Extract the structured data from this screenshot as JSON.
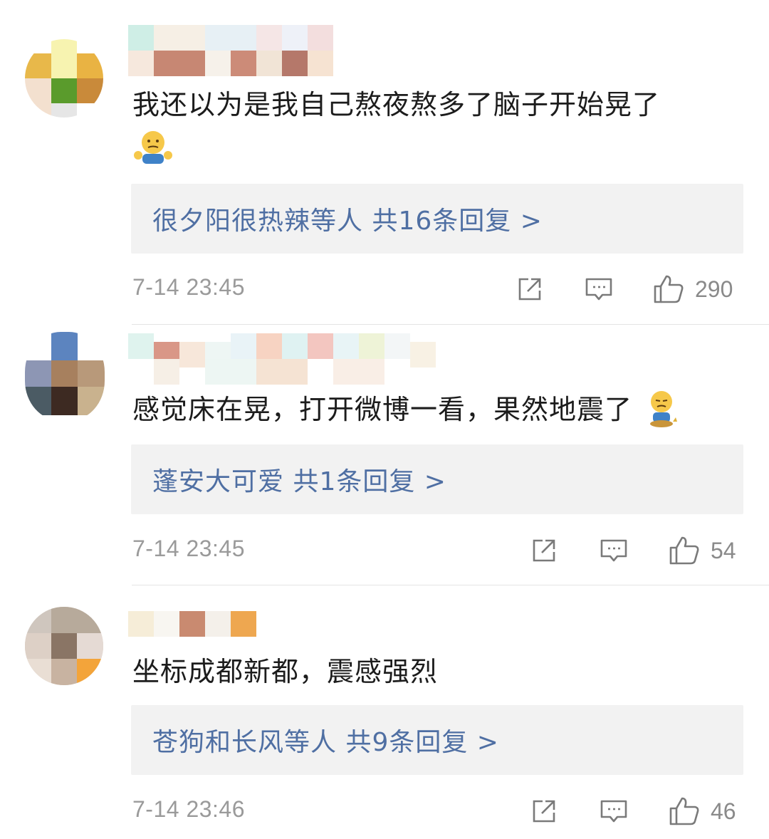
{
  "comments": [
    {
      "text": "我还以为是我自己熬夜熬多了脑子开始晃了",
      "emoji": "shrugging-person-emoji",
      "reply_summary": "很夕阳很热辣等人  共16条回复 >",
      "time": "7-14 23:45",
      "likes": "290"
    },
    {
      "text": "感觉床在晃，打开微博一看，果然地震了",
      "emoji": "awkward-sitting-emoji",
      "reply_summary": "蓬安大可爱  共1条回复 >",
      "time": "7-14 23:45",
      "likes": "54"
    },
    {
      "text": "坐标成都新都，震感强烈",
      "emoji": "",
      "reply_summary": "苍狗和长风等人  共9条回复 >",
      "time": "7-14 23:46",
      "likes": "46"
    }
  ],
  "icons": {
    "share": "share-icon",
    "comment": "comment-icon",
    "like": "like-icon"
  },
  "colors": {
    "reply_link": "#4f6fa3",
    "reply_bg": "#f2f2f2",
    "meta_gray": "#9a9a9a"
  }
}
